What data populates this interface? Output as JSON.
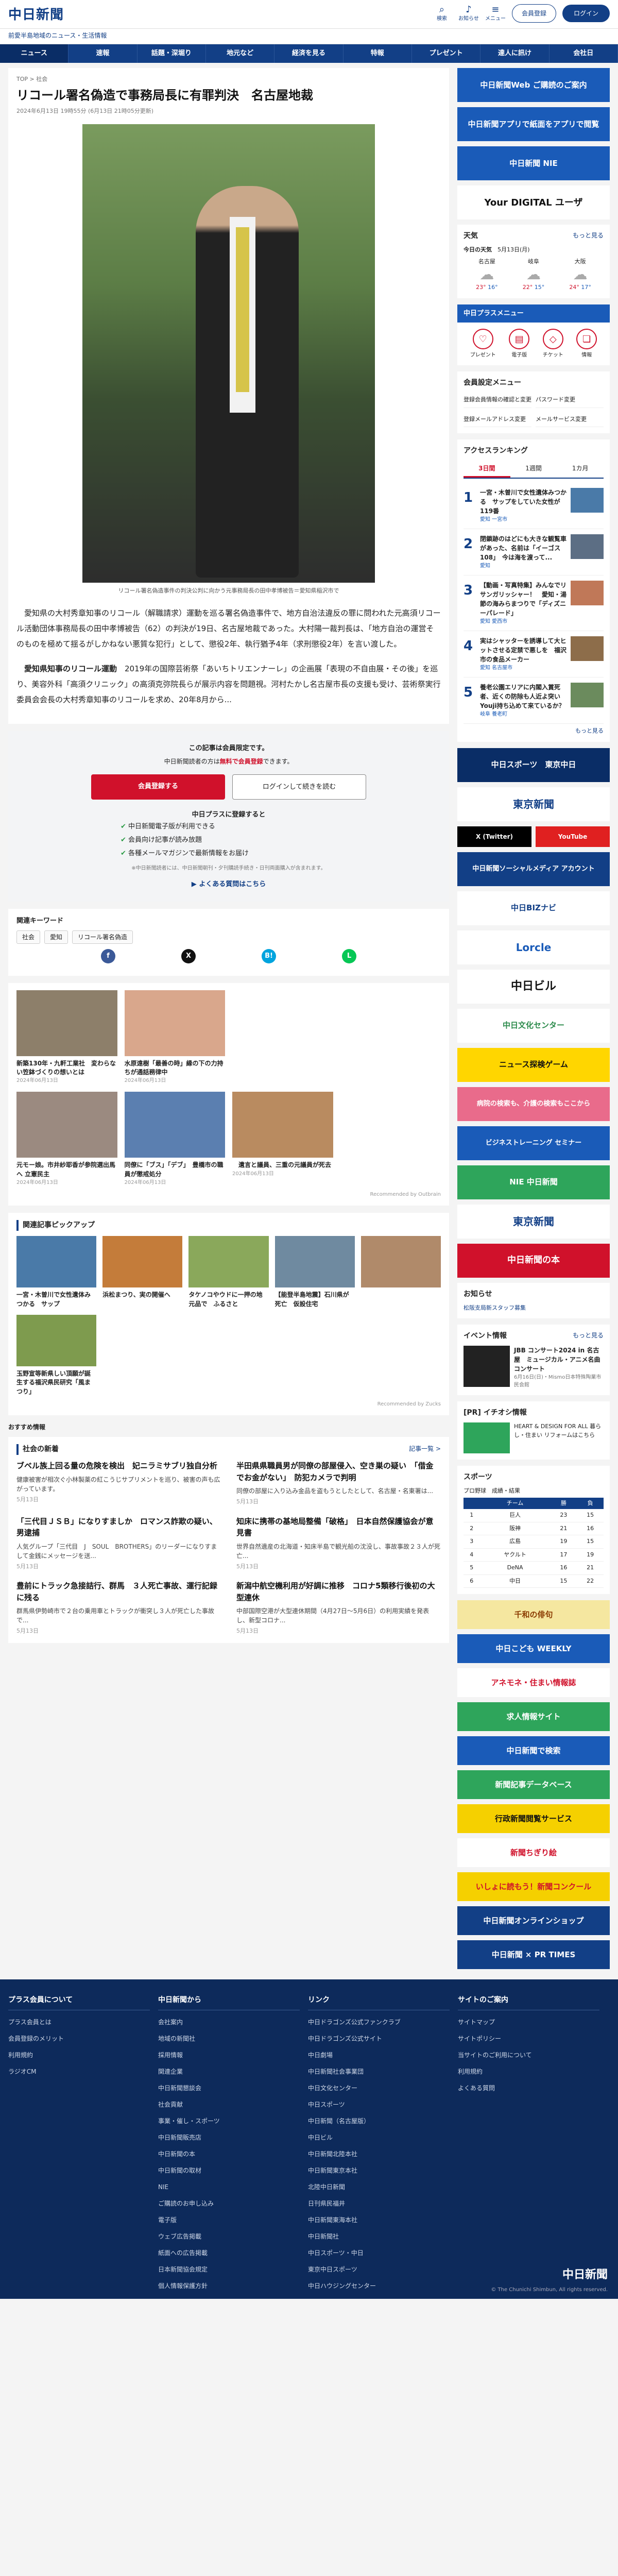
{
  "site": {
    "logo": "中日新聞",
    "tagline": "前愛半島地域のニュース・生活情報",
    "icons": [
      {
        "name": "search-icon",
        "glyph": "⌕",
        "label": "検索"
      },
      {
        "name": "bell-icon",
        "glyph": "♪",
        "label": "お知らせ"
      },
      {
        "name": "menu-icon",
        "glyph": "≡",
        "label": "メニュー"
      }
    ],
    "register": "会員登録",
    "login": "ログイン"
  },
  "gnav": [
    "ニュース",
    "速報",
    "話題・深堀り",
    "地元など",
    "経済を見る",
    "特報",
    "プレゼント",
    "達人に訊け",
    "会社日"
  ],
  "article": {
    "breadcrumb": "TOP > 社会",
    "title": "リコール署名偽造で事務局長に有罪判決　名古屋地裁",
    "date": "2024年6月13日 19時55分 (6月13日 21時05分更新)",
    "caption": "リコール署名偽造事件の判決公判に向かう元事務局長の田中孝博被告＝愛知県稲沢市で",
    "p1": "愛知県の大村秀章知事のリコール（解職請求）運動を巡る署名偽造事件で、地方自治法違反の罪に問われた元高須リコール活動団体事務局長の田中孝博被告（62）の判決が19日、名古屋地裁であった。大村陽一裁判長は、「地方自治の運営そのものを極めて揺るがしかねない悪質な犯行」として、懲役2年、執行猶予4年（求刑懲役2年）を言い渡した。",
    "p2_bold": "愛知県知事のリコール運動",
    "p2": "　2019年の国際芸術祭「あいちトリエンナーレ」の企画展「表現の不自由展・その後」を巡り、美容外科「高須クリニック」の高須克弥院長らが展示内容を問題視。河村たかし名古屋市長の支援も受け、芸術祭実行委員会会長の大村秀章知事のリコールを求め、20年8月から..."
  },
  "paywall": {
    "t1": "この記事は会員限定です。",
    "t2a": "中日新聞読者の方は",
    "t2b": "無料で会員登録",
    "t2c": "できます。",
    "btn1": "会員登録する",
    "btn2": "ログインして続きを読む",
    "plus": "中日プラスに登録すると",
    "items": [
      "中日新聞電子版が利用できる",
      "会員向け記事が読み放題",
      "各種メールマガジンで最新情報をお届け"
    ],
    "note": "※中日新聞読者には、中日新聞朝刊・夕刊購読手続き・日刊両面購入が含まれます。",
    "faq": "よくある質問はこちら"
  },
  "keywords": {
    "title": "関連キーワード",
    "tags": [
      "社会",
      "愛知",
      "リコール署名偽造"
    ]
  },
  "share": [
    {
      "n": "facebook-icon",
      "g": "f",
      "c": "#3b5998"
    },
    {
      "n": "x-icon",
      "g": "X",
      "c": "#111"
    },
    {
      "n": "hatena-icon",
      "g": "B!",
      "c": "#00a4de"
    },
    {
      "n": "line-icon",
      "g": "L",
      "c": "#06c755"
    }
  ],
  "related": [
    {
      "t": "新築130年・九軒工業社　変わらない笠鉢づくりの想いとは",
      "d": "2024年06月13日",
      "c": "#8d7f6a"
    },
    {
      "t": "水原遠樹「最善の時」縁の下の力持ちが通話務律中",
      "d": "2024年06月13日",
      "c": "#d9a78c"
    },
    {
      "t": "",
      "d": "",
      "c": "#fff"
    },
    {
      "t": "",
      "d": "",
      "c": "#fff"
    },
    {
      "t": "元モー娘。市井紗耶香が参院選出馬へ 立憲民主",
      "d": "2024年06月13日",
      "c": "#9b8a80"
    },
    {
      "t": "同僚に「ブス」「デブ」　豊橋市の職員が懲戒処分",
      "d": "2024年06月13日",
      "c": "#5b7fb0"
    },
    {
      "t": "　遺言と議員、三重の元議員が死去",
      "d": "2024年06月13日",
      "c": "#b98b60"
    },
    {
      "t": "",
      "d": "",
      "c": "#fff"
    }
  ],
  "recommended": "Recommended by Outbrain",
  "pickup": {
    "title": "関連記事ピックアップ",
    "items": [
      {
        "t": "一宮・木曽川で女性遺体みつかる　サップ",
        "c": "#4a7aa8"
      },
      {
        "t": "浜松まつり、実の開催へ",
        "c": "#c47c3a"
      },
      {
        "t": "タケノコやウドに一押の地元品で　ふるさと",
        "c": "#8aa85b"
      },
      {
        "t": "【能登半島地震】石川県が死亡　仮設住宅",
        "c": "#6f8aa0"
      },
      {
        "t": "",
        "c": "#b08a6a"
      },
      {
        "t": "玉野宣等新県しい頂願が誕生する福沢県民研究「風まつり」",
        "c": "#7e9b4e"
      }
    ]
  },
  "more_label": "おすすめ情報",
  "society": {
    "title": "社会の新着",
    "more": "記事一覧 >",
    "items": [
      {
        "h": "ブベル族上回る量の危険を検出　妃ニラミサブリ独自分析",
        "b": "健康被害が相次ぐ小林製薬の紅こうじサプリメントを巡り、被害の声も広がっています。",
        "d": "5月13日"
      },
      {
        "h": "半田県県職員男が同僚の部屋侵入、空き巣の疑い　「借金でお金がない」　防犯カメラで判明",
        "b": "同僚の部屋に入り込み金品を盗もうとしたとして、名古屋・名東署は...",
        "d": "5月13日"
      },
      {
        "h": "「三代目ＪＳＢ」になりすましか　ロマンス詐欺の疑い、男逮捕",
        "b": "人気グループ「三代目　J　SOUL　BROTHERS」のリーダーになりすまして金銭にメッセージを送...",
        "d": "5月13日"
      },
      {
        "h": "知床に携帯の基地局整備「破格」　日本自然保護協会が意見書",
        "b": "世界自然遺産の北海道・知床半島で観光船の沈没し、事故事故２３人が死亡...",
        "d": "5月13日"
      },
      {
        "h": "豊前にトラック急接詰行、群馬　３人死亡事故、運行記録に残る",
        "b": "群馬県伊勢崎市で２台の乗用車とトラックが衝突し３人が死亡した事故で...",
        "d": "5月13日"
      },
      {
        "h": "新潟中航空機利用が好調に推移　コロナ5類移行後初の大型連休",
        "b": "中部国際空港が大型連休期間（4月27日〜5月6日）の利用実績を発表し、新型コロナ...",
        "d": "5月13日"
      }
    ]
  },
  "side": {
    "banners": [
      {
        "t": "中日新聞Web ご購読のご案内",
        "c": "#1a5bb8",
        "n": "digital-banner"
      },
      {
        "t": "中日新聞アプリで紙面をアプリで閲覧",
        "c": "#1a5bb8",
        "n": "app-banner"
      },
      {
        "t": "中日新聞 NIE",
        "c": "#1a5bb8",
        "n": "nie-banner"
      },
      {
        "t": "Your DIGITAL ユーザ",
        "c": "#fff",
        "n": "your-digital-banner"
      }
    ],
    "weather": {
      "title": "天気",
      "more": "もっと見る",
      "today": "今日の天気",
      "date": "5月13日(月)",
      "cities": [
        {
          "n": "名古屋",
          "h": "23°",
          "l": "16°"
        },
        {
          "n": "岐阜",
          "h": "22°",
          "l": "15°"
        },
        {
          "n": "大阪",
          "h": "24°",
          "l": "17°"
        }
      ]
    },
    "plusmenu": "中日プラスメニュー",
    "menu": [
      {
        "i": "gift-icon",
        "g": "♡",
        "l": "プレゼント"
      },
      {
        "i": "calendar-icon",
        "g": "▤",
        "l": "電子版"
      },
      {
        "i": "ticket-icon",
        "g": "◇",
        "l": "チケット"
      },
      {
        "i": "book-icon",
        "g": "❏",
        "l": "情報"
      }
    ],
    "member": "会員設定メニュー",
    "memberlinks": [
      "登録会員情報の確認と変更",
      "パスワード変更",
      "登録メールアドレス変更",
      "メールサービス変更"
    ],
    "access": "アクセスランキング",
    "tabs": [
      "3日間",
      "1週間",
      "1カ月"
    ],
    "ranks": [
      {
        "t": "一宮・木曽川で女性遺体みつかる　サップをしていた女性が119番",
        "s": "愛知  一宮市",
        "c": "#4a7aa8"
      },
      {
        "t": "閉鎖跡のはどにも大きな観覧車があった、名前は「イーゴス108」　今は海を渡って...",
        "s": "愛知",
        "c": "#5c6e84"
      },
      {
        "t": "【動画・写真特集】みんなでリサンガリッシャー！　愛知・湯節の海みらまつりで「ディズニーパレード」",
        "s": "愛知  愛西市",
        "c": "#c07858"
      },
      {
        "t": "実はシャッターを誘導して大ヒットさせる定禁で悪しを　福沢市の食品メーカー",
        "s": "愛知  名古屋市",
        "c": "#8d6d4a"
      },
      {
        "t": "養老公園エリアに内閣入賞死者、近くの防除も人近よ突いYouji持ち込めて来ているか？",
        "s": "岐阜  養老町",
        "c": "#6b8b5d"
      }
    ],
    "more": "もっと見る",
    "logos": [
      {
        "t": "中日スポーツ　東京中日",
        "c": "#0a2d66",
        "f": "#fff"
      },
      {
        "t": "東京新聞",
        "c": "#fff",
        "f": "#123f86"
      },
      {
        "t": "中日新聞ソーシャルメディア アカウント",
        "c": "#123f86",
        "f": "#fff"
      },
      {
        "t": "中日BIZナビ",
        "c": "#fff",
        "f": "#123f86"
      },
      {
        "t": "Lorcle",
        "c": "#fff",
        "f": "#1a5bb8"
      },
      {
        "t": "中日ビル",
        "c": "#fff",
        "f": "#111"
      },
      {
        "t": "中日文化センター",
        "c": "#fff",
        "f": "#2a8a4a"
      },
      {
        "t": "ニュース探検ゲーム",
        "c": "#ffd600",
        "f": "#111"
      },
      {
        "t": "病院の検索も、介護の検索もここから",
        "c": "#e96b8b",
        "f": "#fff"
      },
      {
        "t": "ビジネストレーニング セミナー",
        "c": "#1a5bb8",
        "f": "#fff"
      },
      {
        "t": "NIE 中日新聞",
        "c": "#2ea55b",
        "f": "#fff"
      },
      {
        "t": "東京新聞",
        "c": "#fff",
        "f": "#123f86"
      },
      {
        "t": "中日新聞の本",
        "c": "#d0112b",
        "f": "#fff"
      }
    ],
    "social": [
      {
        "t": "X (Twitter)",
        "c": "#000"
      },
      {
        "t": "YouTube",
        "c": "#e02020"
      }
    ],
    "notice": "お知らせ",
    "notice_item": "松阪支局新スタッフ募集",
    "event": "イベント情報",
    "event_item": {
      "t": "JBB コンサート2024 in 名古屋　ミュージカル・アニメ名曲コンサート",
      "d": "6月16日(日)・Mismo日本特殊陶業市民会館"
    },
    "pr": "[PR] イチオシ情報",
    "pr_item": "HEART & DESIGN FOR ALL 暮らし・住まい リフォームはこちら",
    "sports": "スポーツ",
    "sports_sub": "プロ野球　成績・結果",
    "standings": [
      [
        "",
        "チーム",
        "勝",
        "負"
      ],
      [
        "1",
        "巨人",
        "23",
        "15"
      ],
      [
        "2",
        "阪神",
        "21",
        "16"
      ],
      [
        "3",
        "広島",
        "19",
        "15"
      ],
      [
        "4",
        "ヤクルト",
        "17",
        "19"
      ],
      [
        "5",
        "DeNA",
        "16",
        "21"
      ],
      [
        "6",
        "中日",
        "15",
        "22"
      ]
    ],
    "promos": [
      {
        "t": "千和の俳句",
        "c": "#f5e7a0",
        "f": "#8a3a00"
      },
      {
        "t": "中日こども WEEKLY",
        "c": "#1a5bb8",
        "f": "#fff"
      },
      {
        "t": "アネモネ・住まい情報誌",
        "c": "#fff",
        "f": "#d0112b"
      },
      {
        "t": "求人情報サイト",
        "c": "#2ea55b",
        "f": "#fff"
      },
      {
        "t": "中日新聞で検索",
        "c": "#1a5bb8",
        "f": "#fff"
      },
      {
        "t": "新聞記事データベース",
        "c": "#2ea55b",
        "f": "#fff"
      },
      {
        "t": "行政新聞閲覧サービス",
        "c": "#f5d000",
        "f": "#111"
      },
      {
        "t": "新聞ちぎり絵",
        "c": "#fff",
        "f": "#d0112b"
      },
      {
        "t": "いしょに読もう！新聞コンクール",
        "c": "#f5d000",
        "f": "#d0112b"
      },
      {
        "t": "中日新聞オンラインショップ",
        "c": "#123f86",
        "f": "#fff"
      },
      {
        "t": "中日新聞 × PR TIMES",
        "c": "#123f86",
        "f": "#fff"
      }
    ]
  },
  "footer": {
    "cols": [
      {
        "h": "プラス会員について",
        "items": [
          "プラス会員とは",
          "会員登録のメリット",
          "利用規約",
          "ラジオCM"
        ]
      },
      {
        "h": "中日新聞から",
        "items": [
          "会社案内",
          "地域の新聞社",
          "採用情報",
          "関連企業",
          "中日新聞懇談会",
          "社会貢献",
          "事業・催し・スポーツ",
          "中日新聞販売店",
          "中日新聞の本",
          "中日新聞の取材",
          "NIE",
          "ご購読のお申し込み",
          "電子版",
          "ウェブ広告掲載",
          "紙面への広告掲載",
          "日本新聞協会規定",
          "個人情報保護方針"
        ]
      },
      {
        "h": "リンク",
        "items": [
          "中日ドラゴンズ公式ファンクラブ",
          "中日ドラゴンズ公式サイト",
          "中日劇場",
          "中日新聞社会事業団",
          "中日文化センター",
          "中日スポーツ",
          "中日新聞（名古屋版）",
          "中日ビル",
          "中日新聞北陸本社",
          "中日新聞東京本社",
          "北陸中日新聞",
          "日刊県民福井",
          "中日新聞東海本社",
          "中日新聞社",
          "中日スポーツ・中日",
          "東京中日スポーツ",
          "中日ハウジングセンター"
        ]
      },
      {
        "h": "サイトのご案内",
        "items": [
          "サイトマップ",
          "サイトポリシー",
          "当サイトのご利用について",
          "利用規約",
          "よくある質問"
        ]
      }
    ],
    "logo": "中日新聞",
    "copy": "© The Chunichi Shimbun, All rights reserved."
  }
}
